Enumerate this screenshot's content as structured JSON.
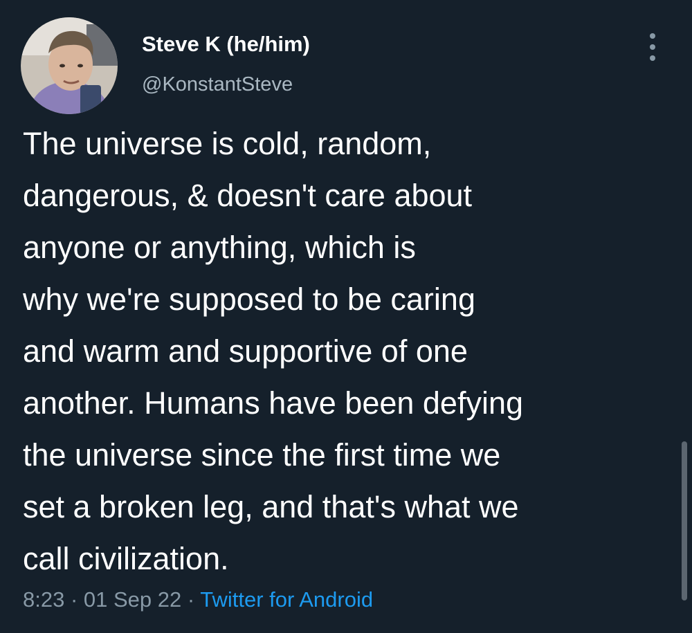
{
  "tweet": {
    "author": {
      "display_name": "Steve K (he/him)",
      "handle": "@KonstantSteve",
      "avatar_icon": "profile-photo"
    },
    "text_lines": [
      "The universe is cold, random,",
      "dangerous, & doesn't care about",
      "anyone or anything, which is",
      "why we're supposed to be caring",
      "and warm and supportive of one",
      "another. Humans have been defying",
      "the universe since the first time we",
      "set a broken leg, and that's what we",
      "call civilization."
    ],
    "meta": {
      "time": "8:23",
      "separator": " · ",
      "date": "01 Sep 22",
      "source": "Twitter for Android"
    },
    "menu_icon": "more-vertical-icon"
  },
  "colors": {
    "background": "#15202b",
    "text": "#ffffff",
    "secondary_text": "#8899a6",
    "link": "#1d9bf0"
  }
}
